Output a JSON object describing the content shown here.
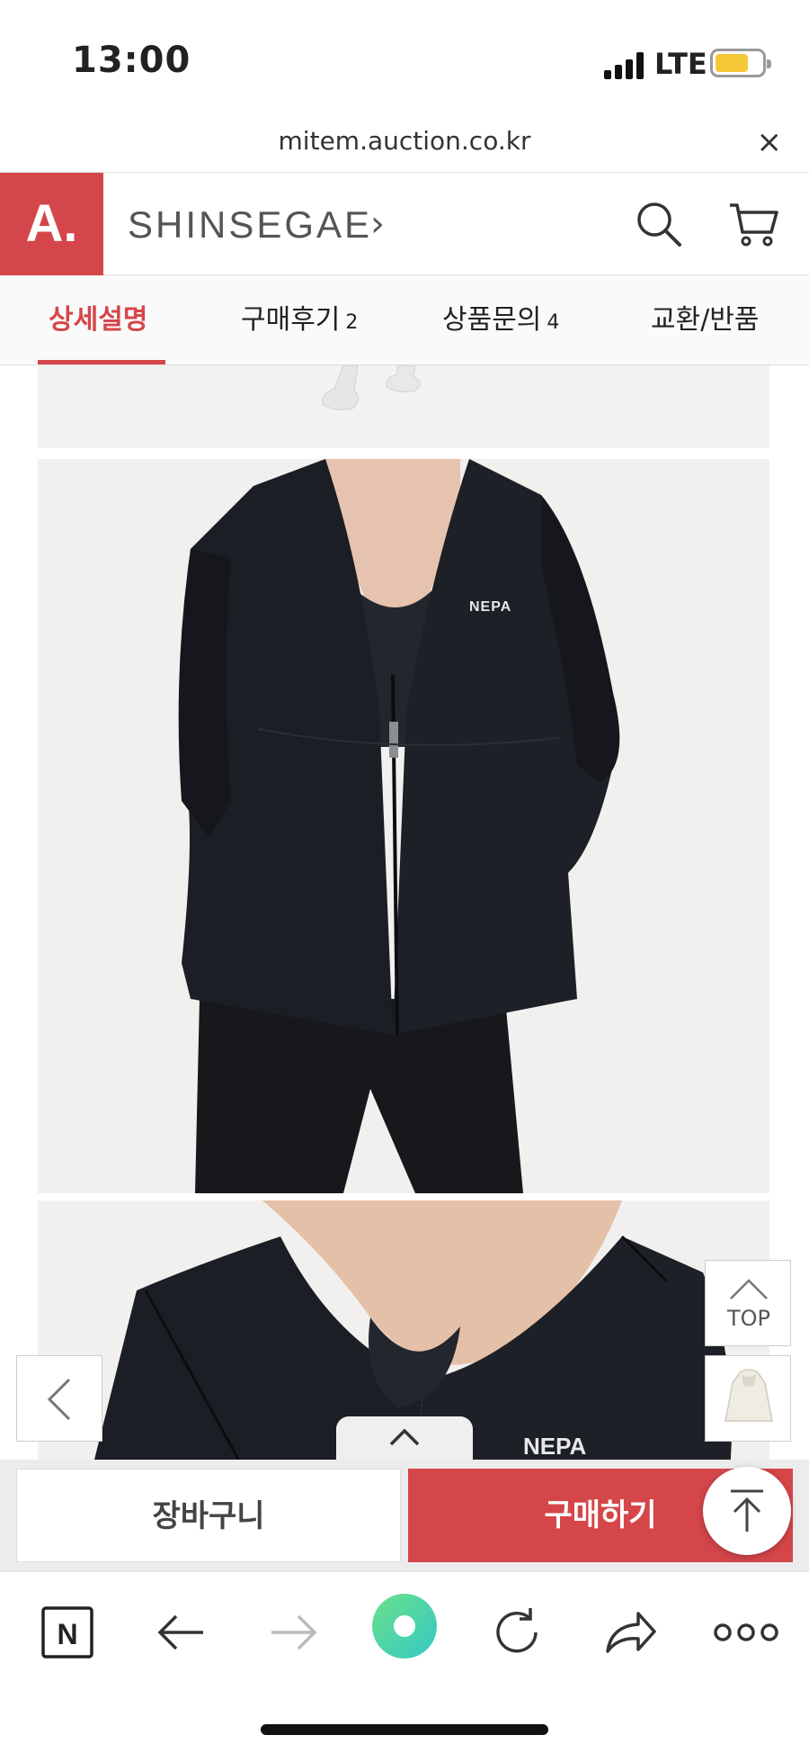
{
  "status_bar": {
    "time": "13:00",
    "network": "LTE",
    "battery_color": "#f5c737"
  },
  "url_bar": {
    "url": "mitem.auction.co.kr",
    "close_glyph": "×"
  },
  "header": {
    "logo": "A.",
    "brand": "SHINSEGAE",
    "brand_chevron": "›",
    "icons": [
      "search-icon",
      "cart-icon"
    ]
  },
  "tabs": [
    {
      "label": "상세설명",
      "count": "",
      "active": true
    },
    {
      "label": "구매후기",
      "count": "2",
      "active": false
    },
    {
      "label": "상품문의",
      "count": "4",
      "active": false
    },
    {
      "label": "교환/반품",
      "count": "",
      "active": false
    }
  ],
  "content": {
    "jacket_logo": "NEPA"
  },
  "floating": {
    "top_label": "TOP"
  },
  "purchase_bar": {
    "cart_label": "장바구니",
    "buy_label": "구매하기"
  },
  "toolbar": {
    "items": [
      "naver-icon",
      "back-icon",
      "forward-icon",
      "green-dot-icon",
      "refresh-icon",
      "share-icon",
      "more-icon"
    ]
  },
  "colors": {
    "accent": "#d5464a",
    "jacket": "#1b1e24"
  }
}
